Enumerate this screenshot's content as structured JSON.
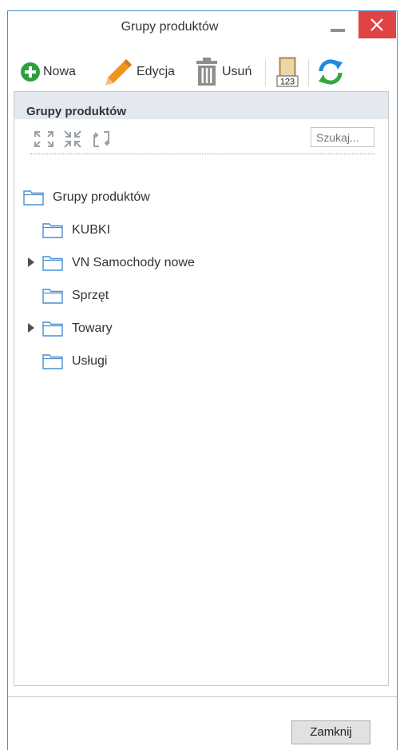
{
  "window": {
    "title": "Grupy produktów"
  },
  "toolbar": {
    "new_label": "Nowa",
    "edit_label": "Edycja",
    "delete_label": "Usuń",
    "numbering_icon_text": "123"
  },
  "panel": {
    "title": "Grupy produktów",
    "search_placeholder": "Szukaj..."
  },
  "tree": {
    "root": "Grupy produktów",
    "items": [
      {
        "label": "KUBKI",
        "expandable": false
      },
      {
        "label": "VN Samochody nowe",
        "expandable": true
      },
      {
        "label": "Sprzęt",
        "expandable": false
      },
      {
        "label": "Towary",
        "expandable": true
      },
      {
        "label": "Usługi",
        "expandable": false
      }
    ]
  },
  "footer": {
    "close_label": "Zamknij"
  },
  "colors": {
    "window_border": "#4e8fd0",
    "close_button_bg": "#e04343",
    "add_icon": "#2e9e3e",
    "edit_icon": "#f0961e",
    "delete_icon": "#8e8e8e",
    "refresh_blue": "#1e8be0",
    "refresh_green": "#35a83c",
    "panel_header_bg": "#e4e9ef",
    "folder_outline": "#4a8fd0"
  },
  "icons": {
    "close": "close-icon",
    "minimize": "minimize-icon",
    "new": "add-circle-icon",
    "edit": "pencil-icon",
    "delete": "trash-icon",
    "numbering": "numbering-icon",
    "refresh": "refresh-icon",
    "expand_all": "expand-all-icon",
    "collapse_all": "collapse-all-icon",
    "sort": "sort-icon",
    "folder": "folder-icon",
    "expander": "triangle-right-icon"
  }
}
